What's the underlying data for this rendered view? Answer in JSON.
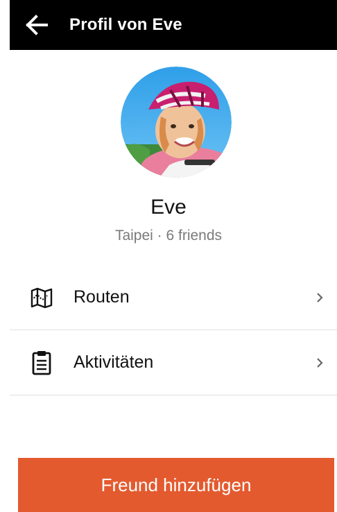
{
  "header": {
    "back_icon": "arrow-left-icon",
    "title": "Profil von Eve"
  },
  "profile": {
    "name": "Eve",
    "subtitle": "Taipei · 6 friends"
  },
  "menu": {
    "items": [
      {
        "label": "Routen",
        "icon": "map-icon"
      },
      {
        "label": "Aktivitäten",
        "icon": "clipboard-icon"
      }
    ]
  },
  "actions": {
    "add_friend_label": "Freund hinzufügen"
  },
  "colors": {
    "header_bg": "#000000",
    "accent": "#e45a2f",
    "divider": "#e1e1e1"
  }
}
